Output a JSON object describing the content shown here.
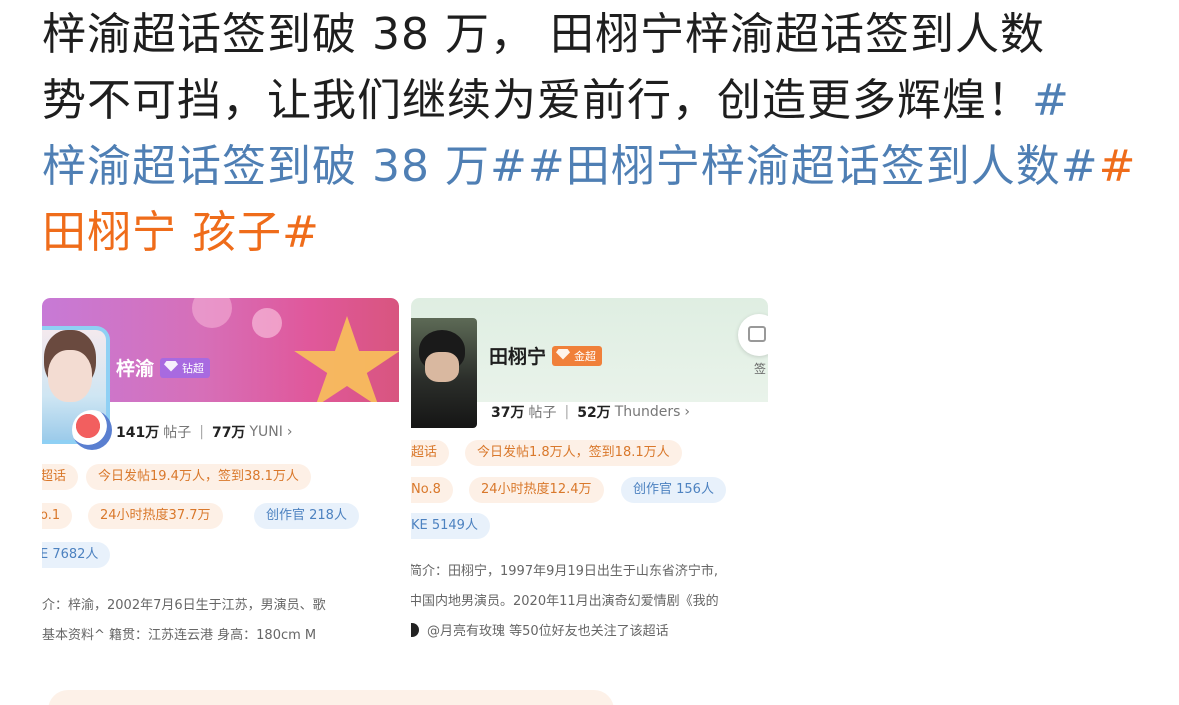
{
  "post": {
    "line1": "梓渝超话签到破 38 万，  田栩宁梓渝超话签到人数",
    "line2": "势不可挡，让我们继续为爱前行，创造更多辉煌！",
    "hash_start": "#",
    "tag1": "梓渝超话签到破 38 万#",
    "tag2": "#田栩宁梓渝超话签到人数#",
    "tag3_hash": "#",
    "tag3": "田栩宁 孩子#"
  },
  "card_left": {
    "name": "梓渝",
    "badge": "钻超",
    "posts_count": "141万",
    "posts_label": "帖子",
    "fans_count": "77万",
    "fans_label": "YUNI",
    "chip1": "超话",
    "chip2": "今日发帖19.4万人，签到38.1万人",
    "chip3": "o.1",
    "chip4": "24小时热度37.7万",
    "chip5": "创作官 218人",
    "chip6": "E 7682人",
    "intro1": "介：梓渝，2002年7月6日生于江苏，男演员、歌",
    "intro2": "基本资料^    籍贯：江苏连云港  身高：180cm  M"
  },
  "card_right": {
    "name": "田栩宁",
    "badge": "金超",
    "sign_label": "签",
    "posts_count": "37万",
    "posts_label": "帖子",
    "fans_count": "52万",
    "fans_label": "Thunders",
    "chip1": "超话",
    "chip2": "今日发帖1.8万人，签到18.1万人",
    "chip3": "No.8",
    "chip4": "24小时热度12.4万",
    "chip5": "创作官 156人",
    "chip6": "KE 5149人",
    "intro1": "简介：田栩宁，1997年9月19日出生于山东省济宁市,",
    "intro2": "中国内地男演员。2020年11月出演奇幻爱情剧《我的",
    "friends": "@月亮有玫瑰 等50位好友也关注了该超话"
  },
  "colors": {
    "tag_blue": "#4f7fb4",
    "tag_orange": "#ef6c1a",
    "chip_orange_text": "#d9782b",
    "chip_blue_text": "#4d82c0"
  }
}
